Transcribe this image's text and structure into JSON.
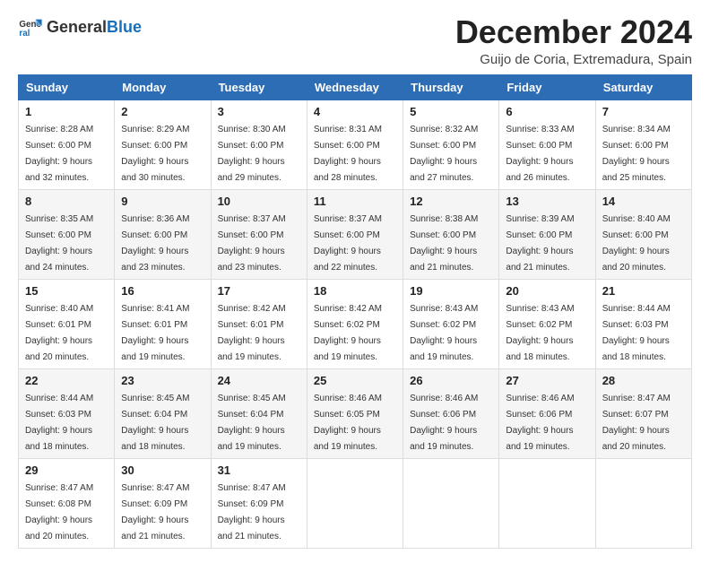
{
  "logo": {
    "general": "General",
    "blue": "Blue"
  },
  "title": "December 2024",
  "subtitle": "Guijo de Coria, Extremadura, Spain",
  "weekdays": [
    "Sunday",
    "Monday",
    "Tuesday",
    "Wednesday",
    "Thursday",
    "Friday",
    "Saturday"
  ],
  "weeks": [
    [
      {
        "day": "1",
        "sunrise": "8:28 AM",
        "sunset": "6:00 PM",
        "daylight": "9 hours and 32 minutes."
      },
      {
        "day": "2",
        "sunrise": "8:29 AM",
        "sunset": "6:00 PM",
        "daylight": "9 hours and 30 minutes."
      },
      {
        "day": "3",
        "sunrise": "8:30 AM",
        "sunset": "6:00 PM",
        "daylight": "9 hours and 29 minutes."
      },
      {
        "day": "4",
        "sunrise": "8:31 AM",
        "sunset": "6:00 PM",
        "daylight": "9 hours and 28 minutes."
      },
      {
        "day": "5",
        "sunrise": "8:32 AM",
        "sunset": "6:00 PM",
        "daylight": "9 hours and 27 minutes."
      },
      {
        "day": "6",
        "sunrise": "8:33 AM",
        "sunset": "6:00 PM",
        "daylight": "9 hours and 26 minutes."
      },
      {
        "day": "7",
        "sunrise": "8:34 AM",
        "sunset": "6:00 PM",
        "daylight": "9 hours and 25 minutes."
      }
    ],
    [
      {
        "day": "8",
        "sunrise": "8:35 AM",
        "sunset": "6:00 PM",
        "daylight": "9 hours and 24 minutes."
      },
      {
        "day": "9",
        "sunrise": "8:36 AM",
        "sunset": "6:00 PM",
        "daylight": "9 hours and 23 minutes."
      },
      {
        "day": "10",
        "sunrise": "8:37 AM",
        "sunset": "6:00 PM",
        "daylight": "9 hours and 23 minutes."
      },
      {
        "day": "11",
        "sunrise": "8:37 AM",
        "sunset": "6:00 PM",
        "daylight": "9 hours and 22 minutes."
      },
      {
        "day": "12",
        "sunrise": "8:38 AM",
        "sunset": "6:00 PM",
        "daylight": "9 hours and 21 minutes."
      },
      {
        "day": "13",
        "sunrise": "8:39 AM",
        "sunset": "6:00 PM",
        "daylight": "9 hours and 21 minutes."
      },
      {
        "day": "14",
        "sunrise": "8:40 AM",
        "sunset": "6:00 PM",
        "daylight": "9 hours and 20 minutes."
      }
    ],
    [
      {
        "day": "15",
        "sunrise": "8:40 AM",
        "sunset": "6:01 PM",
        "daylight": "9 hours and 20 minutes."
      },
      {
        "day": "16",
        "sunrise": "8:41 AM",
        "sunset": "6:01 PM",
        "daylight": "9 hours and 19 minutes."
      },
      {
        "day": "17",
        "sunrise": "8:42 AM",
        "sunset": "6:01 PM",
        "daylight": "9 hours and 19 minutes."
      },
      {
        "day": "18",
        "sunrise": "8:42 AM",
        "sunset": "6:02 PM",
        "daylight": "9 hours and 19 minutes."
      },
      {
        "day": "19",
        "sunrise": "8:43 AM",
        "sunset": "6:02 PM",
        "daylight": "9 hours and 19 minutes."
      },
      {
        "day": "20",
        "sunrise": "8:43 AM",
        "sunset": "6:02 PM",
        "daylight": "9 hours and 18 minutes."
      },
      {
        "day": "21",
        "sunrise": "8:44 AM",
        "sunset": "6:03 PM",
        "daylight": "9 hours and 18 minutes."
      }
    ],
    [
      {
        "day": "22",
        "sunrise": "8:44 AM",
        "sunset": "6:03 PM",
        "daylight": "9 hours and 18 minutes."
      },
      {
        "day": "23",
        "sunrise": "8:45 AM",
        "sunset": "6:04 PM",
        "daylight": "9 hours and 18 minutes."
      },
      {
        "day": "24",
        "sunrise": "8:45 AM",
        "sunset": "6:04 PM",
        "daylight": "9 hours and 19 minutes."
      },
      {
        "day": "25",
        "sunrise": "8:46 AM",
        "sunset": "6:05 PM",
        "daylight": "9 hours and 19 minutes."
      },
      {
        "day": "26",
        "sunrise": "8:46 AM",
        "sunset": "6:06 PM",
        "daylight": "9 hours and 19 minutes."
      },
      {
        "day": "27",
        "sunrise": "8:46 AM",
        "sunset": "6:06 PM",
        "daylight": "9 hours and 19 minutes."
      },
      {
        "day": "28",
        "sunrise": "8:47 AM",
        "sunset": "6:07 PM",
        "daylight": "9 hours and 20 minutes."
      }
    ],
    [
      {
        "day": "29",
        "sunrise": "8:47 AM",
        "sunset": "6:08 PM",
        "daylight": "9 hours and 20 minutes."
      },
      {
        "day": "30",
        "sunrise": "8:47 AM",
        "sunset": "6:09 PM",
        "daylight": "9 hours and 21 minutes."
      },
      {
        "day": "31",
        "sunrise": "8:47 AM",
        "sunset": "6:09 PM",
        "daylight": "9 hours and 21 minutes."
      },
      null,
      null,
      null,
      null
    ]
  ]
}
